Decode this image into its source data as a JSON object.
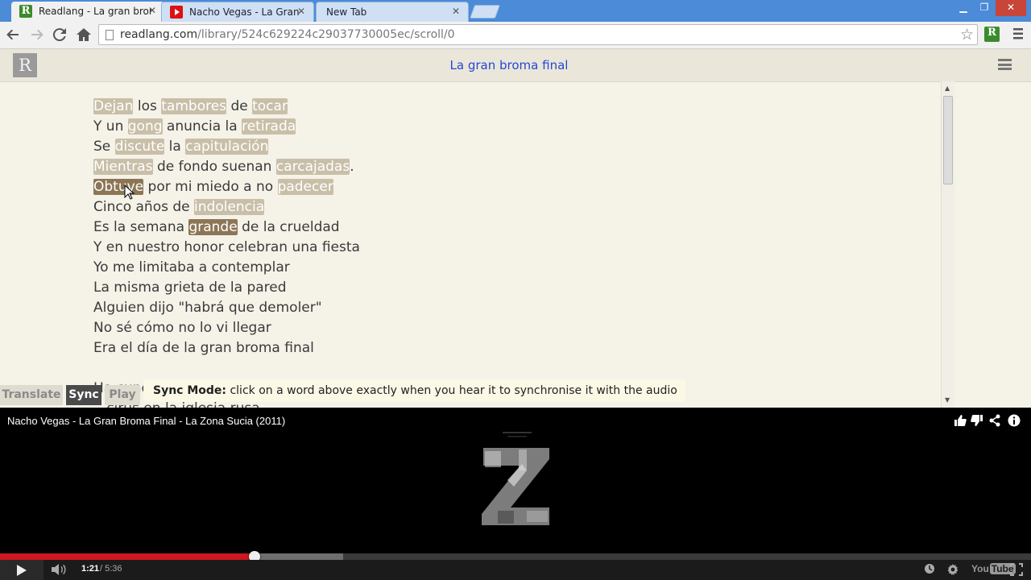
{
  "browser": {
    "tabs": [
      {
        "title": "Readlang - La gran broma",
        "favicon": "readlang-r-icon",
        "active": true
      },
      {
        "title": "Nacho Vegas - La Gran Br",
        "favicon": "youtube-icon",
        "active": false
      },
      {
        "title": "New Tab",
        "favicon": "",
        "active": false
      }
    ],
    "close_glyph": "✕",
    "window_controls": {
      "minimize": "▁",
      "restore": "❐",
      "close": "✕"
    },
    "address": {
      "domain": "readlang.com",
      "path": "/library/524c629224c29037730005ec/scroll/0"
    },
    "extension_letter": "R"
  },
  "readlang": {
    "logo_letter": "R",
    "title": "La gran broma final",
    "lines": [
      [
        {
          "t": "Dejan",
          "s": "hl"
        },
        {
          "t": " los "
        },
        {
          "t": "tambores",
          "s": "hl"
        },
        {
          "t": " de "
        },
        {
          "t": "tocar",
          "s": "hl"
        }
      ],
      [
        {
          "t": "Y un "
        },
        {
          "t": "gong",
          "s": "hl"
        },
        {
          "t": " anuncia la "
        },
        {
          "t": "retirada",
          "s": "hl"
        }
      ],
      [
        {
          "t": "Se "
        },
        {
          "t": "discute",
          "s": "hl"
        },
        {
          "t": " la "
        },
        {
          "t": "capitulación",
          "s": "hl"
        }
      ],
      [
        {
          "t": "Mientras",
          "s": "hl"
        },
        {
          "t": " de fondo suenan "
        },
        {
          "t": "carcajadas",
          "s": "hl"
        },
        {
          "t": "."
        }
      ],
      [
        {
          "t": "Obtuve",
          "s": "dark"
        },
        {
          "t": " por mi miedo a no "
        },
        {
          "t": "padecer",
          "s": "hl"
        }
      ],
      [
        {
          "t": "Cinco años de "
        },
        {
          "t": "indolencia",
          "s": "hl"
        }
      ],
      [
        {
          "t": "Es la semana "
        },
        {
          "t": "grande",
          "s": "dark"
        },
        {
          "t": " de la crueldad"
        }
      ],
      [
        {
          "t": "Y en nuestro honor celebran una fiesta"
        }
      ],
      [
        {
          "t": "Yo me limitaba a contemplar"
        }
      ],
      [
        {
          "t": "La misma grieta de la pared"
        }
      ],
      [
        {
          "t": "Alguien dijo \"habrá que demoler\""
        }
      ],
      [
        {
          "t": "No sé cómo no lo vi llegar"
        }
      ],
      [
        {
          "t": "Era el día de la gran broma final"
        }
      ],
      [
        {
          "t": ""
        }
      ],
      [
        {
          "t": "Ha cundido el pánico en Madrid"
        }
      ],
      [
        {
          "t": "...cirus en la iglesia rusa"
        }
      ]
    ],
    "modes": {
      "translate": "Translate",
      "sync": "Sync",
      "play": "Play"
    },
    "sync_message": {
      "label": "Sync Mode:",
      "text": " click on a word above exactly when you hear it to synchronise it with the audio"
    }
  },
  "player": {
    "video_title": "Nacho Vegas - La Gran Broma Final - La Zona Sucia (2011)",
    "top_icons": [
      "like-icon",
      "dislike-icon",
      "share-icon",
      "info-icon"
    ],
    "current_time": "1:21",
    "duration_text": "/ 5:36",
    "progress": 0.247,
    "buffered": 0.333,
    "logo": {
      "you": "You",
      "tube": "Tube"
    },
    "colors": {
      "played": "#cc181e"
    }
  }
}
